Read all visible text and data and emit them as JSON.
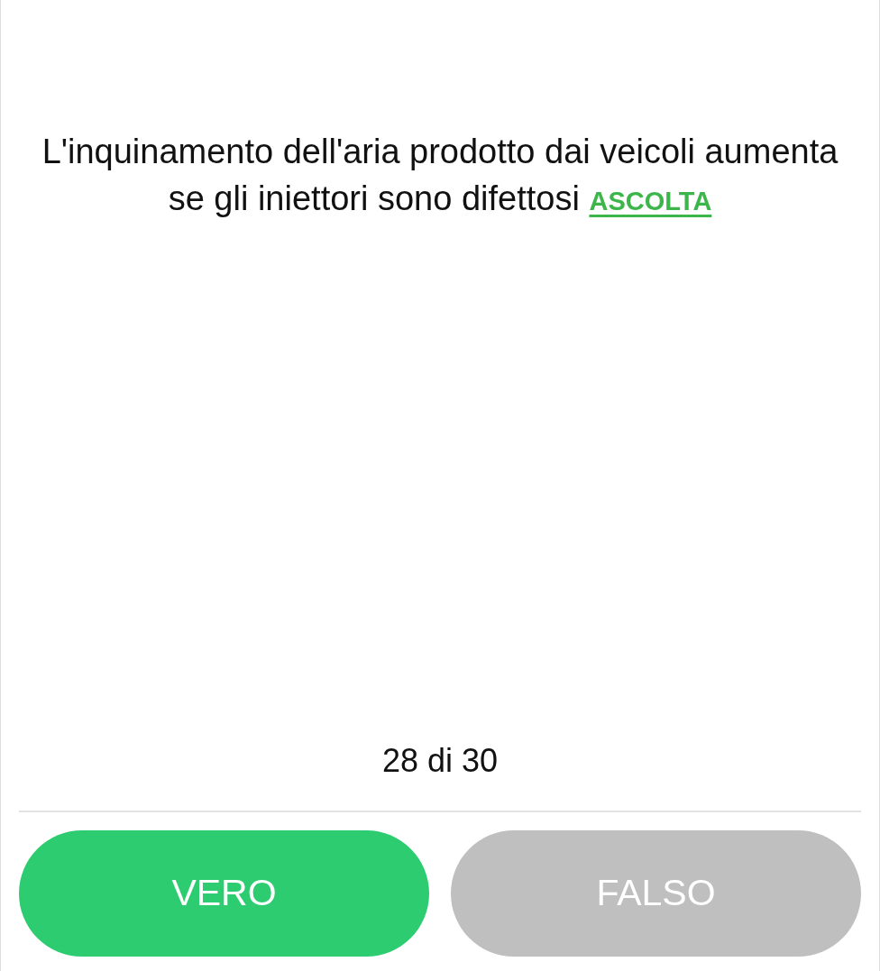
{
  "question": {
    "text": "L'inquinamento dell'aria prodotto dai veicoli aumenta se gli iniettori sono difettosi",
    "listen_link": "ASCOLTA"
  },
  "progress": "28 di 30",
  "buttons": [
    {
      "label": "VERO",
      "color": "#2ecc71"
    },
    {
      "label": "FALSO",
      "color": "#bfbfbf"
    }
  ]
}
